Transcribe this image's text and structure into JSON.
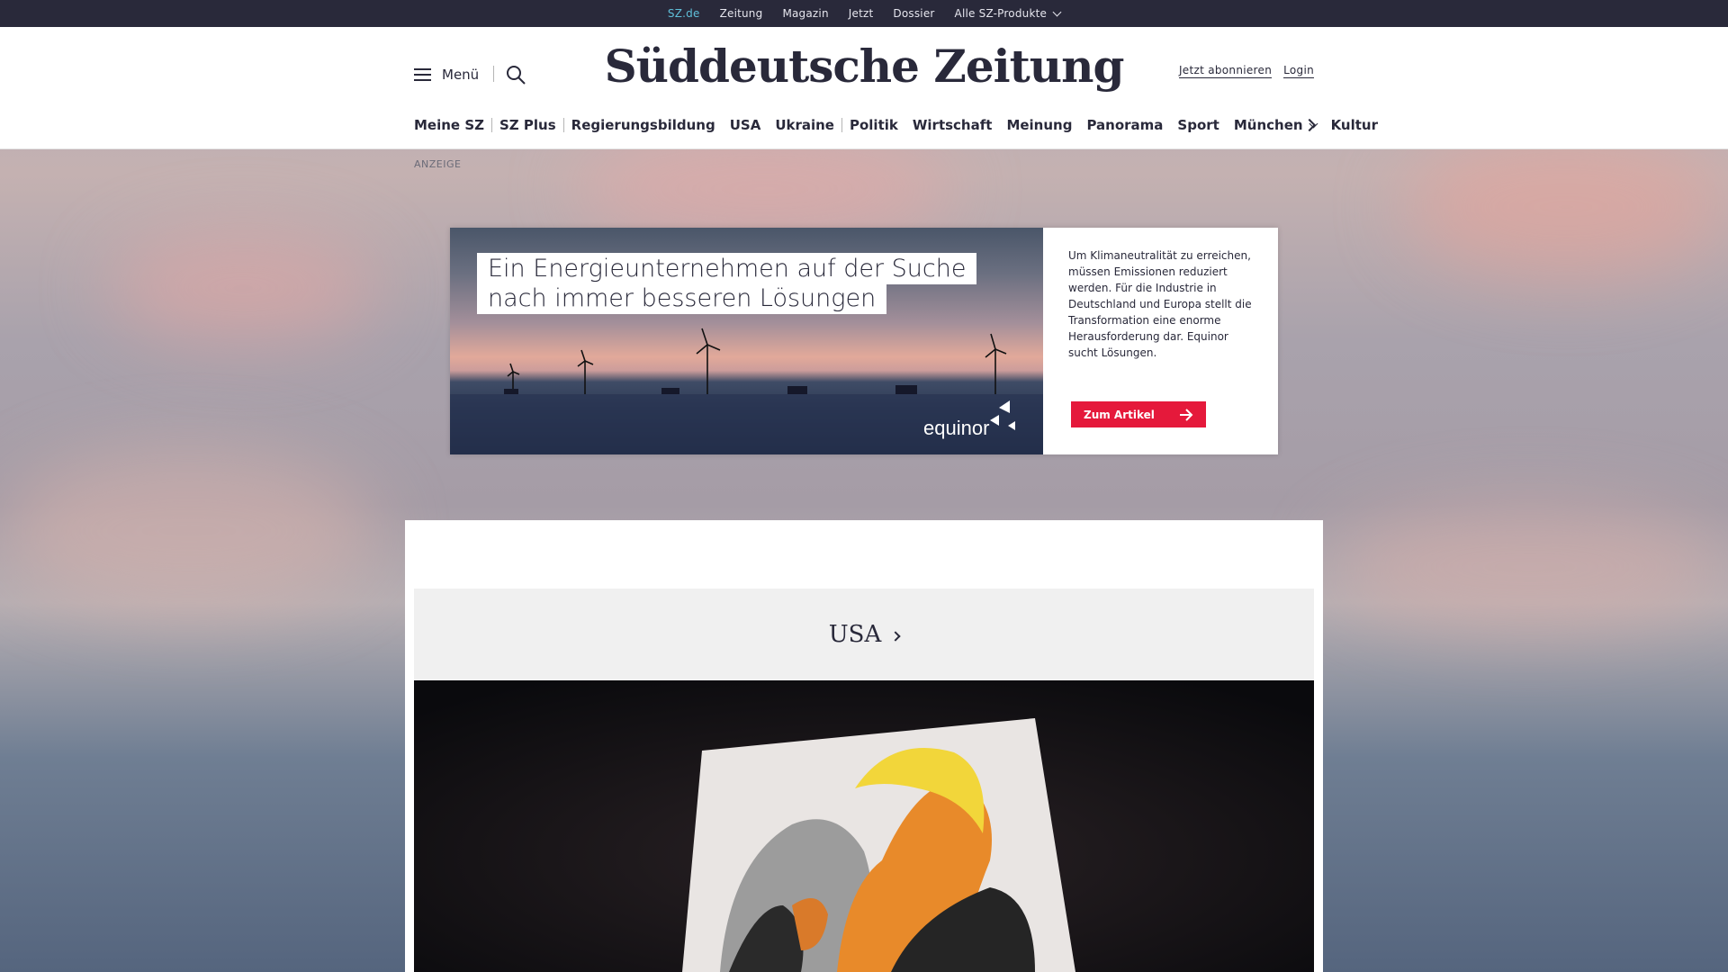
{
  "topbar": {
    "items": [
      {
        "label": "SZ.de",
        "active": true
      },
      {
        "label": "Zeitung"
      },
      {
        "label": "Magazin"
      },
      {
        "label": "Jetzt"
      },
      {
        "label": "Dossier"
      },
      {
        "label": "Alle SZ-Produkte",
        "has_dropdown": true
      }
    ]
  },
  "header": {
    "menu_label": "Menü",
    "logo": "Süddeutsche Zeitung",
    "subscribe": "Jetzt abonnieren",
    "login": "Login"
  },
  "nav": {
    "items": [
      "Meine SZ",
      "SZ Plus",
      "Regierungsbildung",
      "USA",
      "Ukraine",
      "Politik",
      "Wirtschaft",
      "Meinung",
      "Panorama",
      "Sport",
      "München",
      "Kultur"
    ]
  },
  "ad": {
    "label": "ANZEIGE",
    "headline_line1": "Ein Energieunternehmen auf der Suche",
    "headline_line2": "nach immer besseren Lösungen",
    "text": "Um Klimaneutralität zu erreichen, müssen Emissionen reduziert werden. Für die Industrie in Deutschland und Europa stellt die Transformation eine enorme Herausforderung dar. Equinor sucht Lösungen.",
    "cta": "Zum Artikel",
    "brand": "equinor"
  },
  "section": {
    "title": "USA"
  },
  "colors": {
    "topbar_bg": "#29293a",
    "active_link": "#5fbfd9",
    "cta_red": "#e5193b",
    "text": "#29293a"
  }
}
